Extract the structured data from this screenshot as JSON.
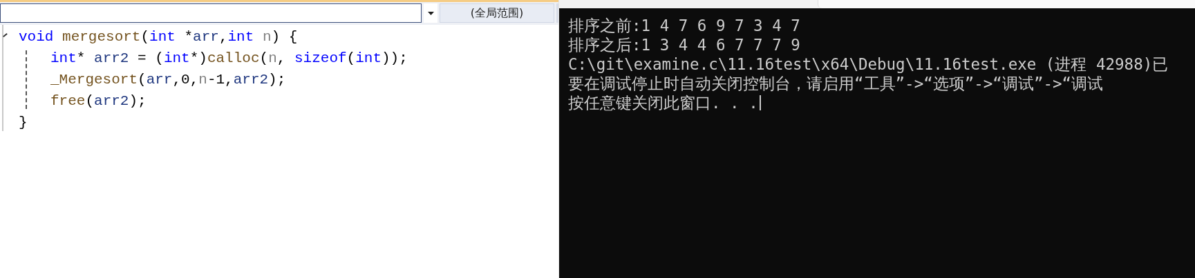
{
  "editor": {
    "scope_dropdown": {
      "scope_label": "(全局范围)"
    },
    "code_lines": [
      {
        "tokens": [
          {
            "text": "void",
            "kind": "keyword"
          },
          {
            "text": " mergesort",
            "kind": "function"
          },
          {
            "text": "(",
            "kind": "plain"
          },
          {
            "text": "int",
            "kind": "keyword"
          },
          {
            "text": " *",
            "kind": "plain"
          },
          {
            "text": "arr",
            "kind": "variable"
          },
          {
            "text": ",",
            "kind": "plain"
          },
          {
            "text": "int",
            "kind": "keyword"
          },
          {
            "text": " n",
            "kind": "parameter"
          },
          {
            "text": ") {",
            "kind": "plain"
          }
        ],
        "children": [
          {
            "tokens": [
              {
                "text": "int",
                "kind": "keyword"
              },
              {
                "text": "* ",
                "kind": "plain"
              },
              {
                "text": "arr2",
                "kind": "variable"
              },
              {
                "text": " = (",
                "kind": "plain"
              },
              {
                "text": "int",
                "kind": "keyword"
              },
              {
                "text": "*)",
                "kind": "plain"
              },
              {
                "text": "calloc",
                "kind": "function"
              },
              {
                "text": "(",
                "kind": "plain"
              },
              {
                "text": "n",
                "kind": "parameter"
              },
              {
                "text": ", ",
                "kind": "plain"
              },
              {
                "text": "sizeof",
                "kind": "keyword"
              },
              {
                "text": "(",
                "kind": "plain"
              },
              {
                "text": "int",
                "kind": "keyword"
              },
              {
                "text": "));",
                "kind": "plain"
              }
            ]
          },
          {
            "tokens": [
              {
                "text": "_Mergesort",
                "kind": "function"
              },
              {
                "text": "(",
                "kind": "plain"
              },
              {
                "text": "arr",
                "kind": "variable"
              },
              {
                "text": ",0,",
                "kind": "plain"
              },
              {
                "text": "n",
                "kind": "parameter"
              },
              {
                "text": "-1,",
                "kind": "plain"
              },
              {
                "text": "arr2",
                "kind": "variable"
              },
              {
                "text": ");",
                "kind": "plain"
              }
            ]
          },
          {
            "tokens": [
              {
                "text": "free",
                "kind": "function"
              },
              {
                "text": "(",
                "kind": "plain"
              },
              {
                "text": "arr2",
                "kind": "variable"
              },
              {
                "text": ");",
                "kind": "plain"
              }
            ]
          }
        ]
      },
      {
        "tokens": [
          {
            "text": "}",
            "kind": "plain"
          }
        ]
      }
    ]
  },
  "console": {
    "lines": [
      "排序之前:1 4 7 6 9 7 3 4 7",
      "排序之后:1 3 4 4 6 7 7 7 9",
      "C:\\git\\examine.c\\11.16test\\x64\\Debug\\11.16test.exe (进程 42988)已",
      "要在调试停止时自动关闭控制台，请启用“工具”->“选项”->“调试”->“调试",
      "按任意键关闭此窗口. . ."
    ],
    "cursor_visible": true
  }
}
